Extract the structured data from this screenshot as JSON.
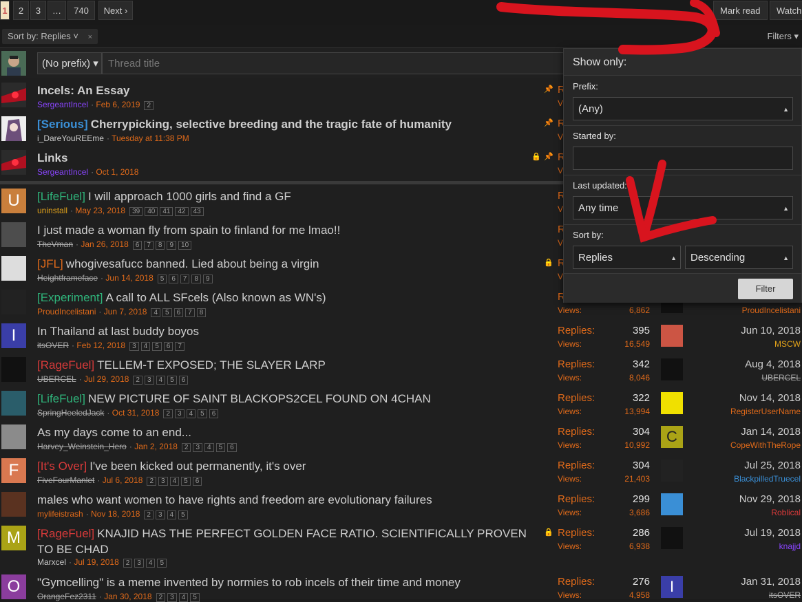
{
  "pagination": {
    "pages": [
      "1",
      "2",
      "3",
      "…",
      "740"
    ],
    "next_label": "Next"
  },
  "header_actions": {
    "mark_read": "Mark read",
    "watch": "Watch"
  },
  "sort_chip": {
    "label": "Sort by:",
    "value": "Replies",
    "chevron": "˅",
    "remove": "×"
  },
  "filters_label": "Filters",
  "quick_thread": {
    "prefix": "(No prefix)",
    "placeholder": "Thread title"
  },
  "threads": [
    {
      "prefix": "",
      "title": "Incels: An Essay",
      "sticky": true,
      "user": "SergeantIncel",
      "date": "Feb 6, 2019",
      "pages": [
        "2"
      ],
      "icons": [
        "pin"
      ],
      "stat_a": "R",
      "stat_b": "V"
    },
    {
      "prefix": "[Serious]",
      "title": "Cherrypicking, selective breeding and the tragic fate of humanity",
      "sticky": true,
      "user": "i_DareYouREEme",
      "date": "Tuesday at 11:38 PM",
      "pages": [],
      "icons": [
        "pin"
      ],
      "stat_a": "R",
      "stat_b": "V"
    },
    {
      "prefix": "",
      "title": "Links",
      "sticky": true,
      "user": "SergeantIncel",
      "date": "Oct 1, 2018",
      "pages": [],
      "icons": [
        "lock",
        "pin"
      ],
      "stat_a": "R",
      "stat_b": "V"
    },
    {
      "prefix": "[LifeFuel]",
      "title": "I will approach 1000 girls and find a GF",
      "user": "uninstall",
      "date": "May 23, 2018",
      "pages": [
        "39",
        "40",
        "41",
        "42",
        "43"
      ],
      "stat_a": "R",
      "stat_b": "V"
    },
    {
      "prefix": "",
      "title": "I just made a woman fly from spain to finland for me lmao!!",
      "user": "TheVman",
      "date": "Jan 26, 2018",
      "pages": [
        "6",
        "7",
        "8",
        "9",
        "10"
      ],
      "stat_a": "R",
      "stat_b": "V"
    },
    {
      "prefix": "[JFL]",
      "title": "whogivesafucc banned. Lied about being a virgin",
      "user": "Heightframeface",
      "date": "Jun 14, 2018",
      "pages": [
        "5",
        "6",
        "7",
        "8",
        "9"
      ],
      "icons": [
        "lock"
      ],
      "stat_a": "R",
      "stat_b": "V"
    },
    {
      "prefix": "[Experiment]",
      "title": "A call to ALL SFcels (Also known as WN's)",
      "user": "ProudIncelistani",
      "date": "Jun 7, 2018",
      "pages": [
        "4",
        "5",
        "6",
        "7",
        "8"
      ],
      "stat_a": "R",
      "views_label": "Views:",
      "views": "6,862",
      "last_user": "ProudIncelistani"
    },
    {
      "prefix": "",
      "title": "In Thailand at last buddy boyos",
      "user": "itsOVER",
      "date": "Feb 12, 2018",
      "pages": [
        "3",
        "4",
        "5",
        "6",
        "7"
      ],
      "replies_label": "Replies:",
      "replies": "395",
      "views_label": "Views:",
      "views": "16,549",
      "last_date": "Jun 10, 2018",
      "last_user": "MSCW"
    },
    {
      "prefix": "[RageFuel]",
      "title": "TELLEM-T EXPOSED; THE SLAYER LARP",
      "user": "UBERCEL",
      "date": "Jul 29, 2018",
      "pages": [
        "2",
        "3",
        "4",
        "5",
        "6"
      ],
      "replies_label": "Replies:",
      "replies": "342",
      "views_label": "Views:",
      "views": "8,046",
      "last_date": "Aug 4, 2018",
      "last_user": "UBERCEL"
    },
    {
      "prefix": "[LifeFuel]",
      "title": "NEW PICTURE OF SAINT BLACKOPS2CEL FOUND ON 4CHAN",
      "user": "SpringHeeledJack",
      "date": "Oct 31, 2018",
      "pages": [
        "2",
        "3",
        "4",
        "5",
        "6"
      ],
      "replies_label": "Replies:",
      "replies": "322",
      "views_label": "Views:",
      "views": "13,994",
      "last_date": "Nov 14, 2018",
      "last_user": "RegisterUserName"
    },
    {
      "prefix": "",
      "title": "As my days come to an end...",
      "user": "Harvey_Weinstein_Hero",
      "date": "Jan 2, 2018",
      "pages": [
        "2",
        "3",
        "4",
        "5",
        "6"
      ],
      "replies_label": "Replies:",
      "replies": "304",
      "views_label": "Views:",
      "views": "10,992",
      "last_date": "Jan 14, 2018",
      "last_user": "CopeWithTheRope"
    },
    {
      "prefix": "[It's Over]",
      "title": "I've been kicked out permanently, it's over",
      "user": "FiveFourManlet",
      "date": "Jul 6, 2018",
      "pages": [
        "2",
        "3",
        "4",
        "5",
        "6"
      ],
      "replies_label": "Replies:",
      "replies": "304",
      "views_label": "Views:",
      "views": "21,403",
      "last_date": "Jul 25, 2018",
      "last_user": "BlackpilledTruecel"
    },
    {
      "prefix": "",
      "title": "males who want women to have rights and freedom are evolutionary failures",
      "user": "mylifeistrash",
      "date": "Nov 18, 2018",
      "pages": [
        "2",
        "3",
        "4",
        "5"
      ],
      "replies_label": "Replies:",
      "replies": "299",
      "views_label": "Views:",
      "views": "3,686",
      "last_date": "Nov 29, 2018",
      "last_user": "Roblical"
    },
    {
      "prefix": "[RageFuel]",
      "title": "KNAJID HAS THE PERFECT GOLDEN FACE RATIO. SCIENTIFICALLY PROVEN",
      "title2": "TO BE CHAD",
      "user": "Marxcel",
      "date": "Jul 19, 2018",
      "pages": [
        "2",
        "3",
        "4",
        "5"
      ],
      "icons": [
        "lock"
      ],
      "replies_label": "Replies:",
      "replies": "286",
      "views_label": "Views:",
      "views": "6,938",
      "last_date": "Jul 19, 2018",
      "last_user": "knajjd"
    },
    {
      "prefix": "",
      "title": "\"Gymcelling\" is a meme invented by normies to rob incels of their time and money",
      "user": "OrangeFez2311",
      "date": "Jan 30, 2018",
      "pages": [
        "2",
        "3",
        "4",
        "5"
      ],
      "replies_label": "Replies:",
      "replies": "276",
      "views_label": "Views:",
      "views": "4,958",
      "last_date": "Jan 31, 2018",
      "last_user": "itsOVER"
    }
  ],
  "avatar_letters": {
    "uninstall": "U",
    "itsOVER": "I",
    "FiveFourManlet": "F",
    "Marxcel": "M",
    "OrangeFez2311": "O",
    "CopeWithTheRope": "C",
    "itsOVER_last": "I"
  },
  "filter_popup": {
    "title": "Show only:",
    "prefix_label": "Prefix:",
    "prefix_value": "(Any)",
    "started_by_label": "Started by:",
    "started_by_value": "",
    "last_updated_label": "Last updated:",
    "last_updated_value": "Any time",
    "sort_label": "Sort by:",
    "sort_field": "Replies",
    "sort_order": "Descending",
    "submit": "Filter"
  },
  "colors": {
    "accent_orange": "#e06a1a",
    "annotation_red": "#d8141e",
    "sticky_pin": "#e0831a"
  }
}
